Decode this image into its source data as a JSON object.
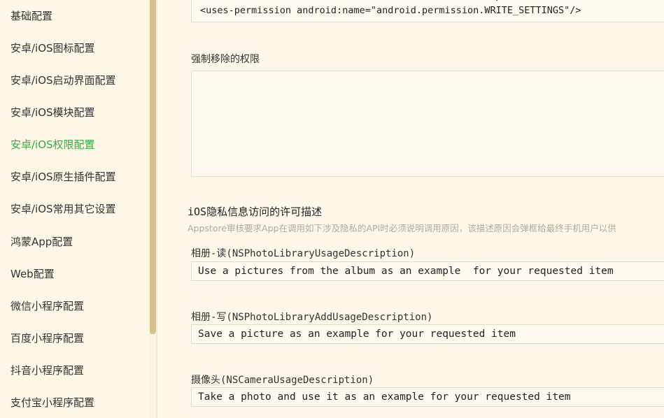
{
  "sidebar": {
    "items": [
      {
        "label": "基础配置",
        "active": false
      },
      {
        "label": "安卓/iOS图标配置",
        "active": false
      },
      {
        "label": "安卓/iOS启动界面配置",
        "active": false
      },
      {
        "label": "安卓/iOS模块配置",
        "active": false
      },
      {
        "label": "安卓/iOS权限配置",
        "active": true
      },
      {
        "label": "安卓/iOS原生插件配置",
        "active": false
      },
      {
        "label": "安卓/iOS常用其它设置",
        "active": false
      },
      {
        "label": "鸿蒙App配置",
        "active": false
      },
      {
        "label": "Web配置",
        "active": false
      },
      {
        "label": "微信小程序配置",
        "active": false
      },
      {
        "label": "百度小程序配置",
        "active": false
      },
      {
        "label": "抖音小程序配置",
        "active": false
      },
      {
        "label": "支付宝小程序配置",
        "active": false
      }
    ],
    "active_color": "#3aa845"
  },
  "permissions": {
    "code_lines": "<uses-feature android:name=\"android.hardware.camera\"/>\n<uses-permission android:name=\"android.permission.WRITE_SETTINGS\"/>",
    "removed_label": "强制移除的权限",
    "removed_value": ""
  },
  "ios_privacy": {
    "title": "iOS隐私信息访问的许可描述",
    "description": "Appstore审核要求App在调用如下涉及隐私的API时必须说明调用原因，该描述原因会弹框给最终手机用户以供",
    "fields": [
      {
        "label": "相册-读(NSPhotoLibraryUsageDescription)",
        "value": "Use a pictures from the album as an example  for your requested item"
      },
      {
        "label": "相册-写(NSPhotoLibraryAddUsageDescription)",
        "value": "Save a picture as an example for your requested item"
      },
      {
        "label": "摄像头(NSCameraUsageDescription)",
        "value": "Take a photo and use it as an example for your requested item"
      }
    ]
  }
}
